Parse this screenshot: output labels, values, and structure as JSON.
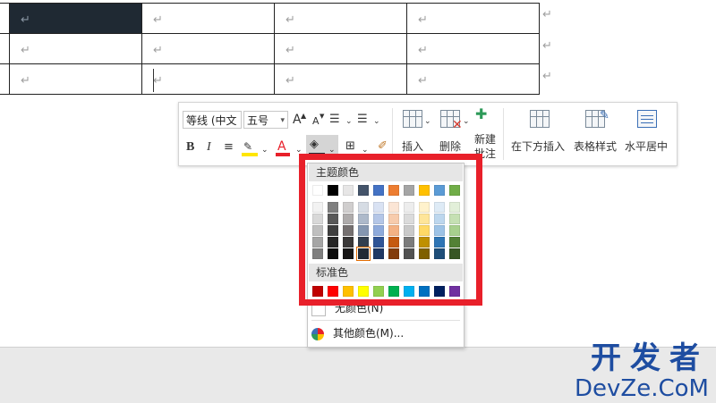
{
  "document": {
    "paragraph_mark": "↵",
    "rows": [
      {
        "cells": [
          "↵",
          "↵",
          "↵",
          "↵"
        ]
      },
      {
        "cells": [
          "↵",
          "↵",
          "↵",
          "↵"
        ]
      },
      {
        "cells": [
          "↵",
          "↵",
          "↵",
          "↵"
        ]
      }
    ]
  },
  "toolbar": {
    "font_name": "等线 (中文",
    "font_size": "五号",
    "grow_font": "A",
    "shrink_font": "A",
    "bold": "B",
    "italic": "I",
    "font_color_letter": "A",
    "insert_label": "插入",
    "delete_label": "删除",
    "new_comment_line1": "新建",
    "new_comment_line2": "批注",
    "insert_below_label": "在下方插入",
    "table_style_label": "表格样式",
    "center_label": "水平居中",
    "accent_highlight": "#ffe600",
    "accent_font_color": "#e8202a"
  },
  "color_panel": {
    "theme_colors_label": "主题颜色",
    "standard_colors_label": "标准色",
    "no_color_label": "无颜色(N)",
    "more_colors_label": "其他颜色(M)...",
    "theme_rows": [
      [
        "#ffffff",
        "#000000",
        "#e7e6e6",
        "#44546a",
        "#4472c4",
        "#ed7d31",
        "#a5a5a5",
        "#ffc000",
        "#5b9bd5",
        "#70ad47"
      ],
      [
        "#f2f2f2",
        "#7f7f7f",
        "#d0cece",
        "#d6dce4",
        "#d9e2f3",
        "#fbe5d5",
        "#ededed",
        "#fff2cc",
        "#deebf6",
        "#e2efd9"
      ],
      [
        "#d8d8d8",
        "#595959",
        "#aeabab",
        "#adb9ca",
        "#b4c6e7",
        "#f7cbac",
        "#dbdbdb",
        "#fee599",
        "#bdd7ee",
        "#c5e0b3"
      ],
      [
        "#bfbfbf",
        "#3f3f3f",
        "#757070",
        "#8496b0",
        "#8eaadb",
        "#f4b183",
        "#c9c9c9",
        "#ffd965",
        "#9dc3e6",
        "#a8d08d"
      ],
      [
        "#a5a5a5",
        "#262626",
        "#3a3838",
        "#323f4f",
        "#2f5496",
        "#c55a11",
        "#7b7b7b",
        "#bf9000",
        "#2e75b5",
        "#538135"
      ],
      [
        "#7f7f7f",
        "#0c0c0c",
        "#171616",
        "#222a35",
        "#1f3864",
        "#833c0b",
        "#525252",
        "#7f6000",
        "#1e4e79",
        "#375623"
      ]
    ],
    "standard_colors": [
      "#c00000",
      "#ff0000",
      "#ffc000",
      "#ffff00",
      "#92d050",
      "#00b050",
      "#00b0f0",
      "#0070c0",
      "#002060",
      "#7030a0"
    ]
  },
  "watermark": {
    "cn": "开发者",
    "en": "DevZe.CoM"
  }
}
